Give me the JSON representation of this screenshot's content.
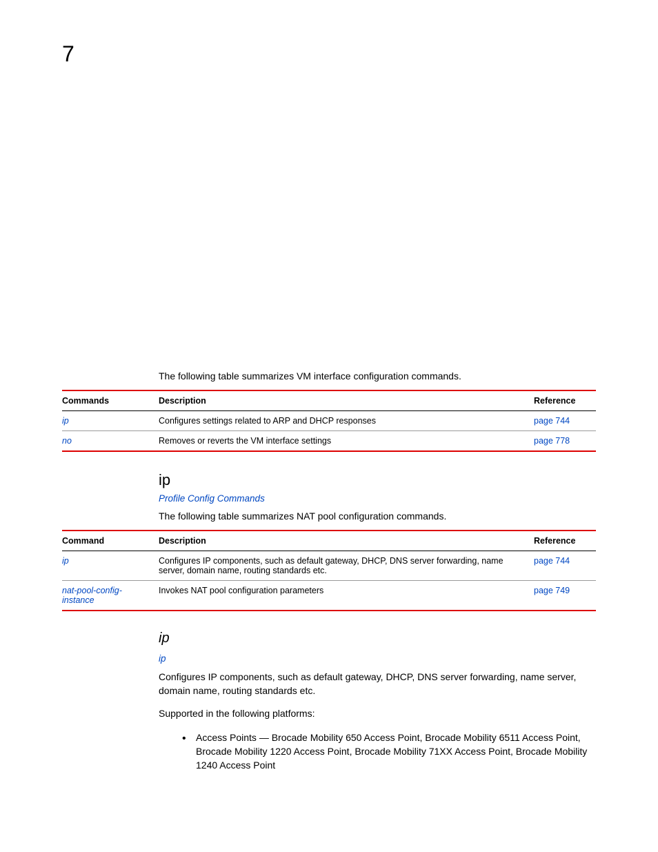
{
  "chapter": "7",
  "intro1": "The following table summarizes VM interface configuration commands.",
  "table1": {
    "headers": {
      "c1": "Commands",
      "c2": "Description",
      "c3": "Reference"
    },
    "rows": [
      {
        "cmd": "ip",
        "desc": "Configures settings related to ARP and DHCP responses",
        "ref": "page 744"
      },
      {
        "cmd": "no",
        "desc": "Removes or reverts the VM interface settings",
        "ref": "page 778"
      }
    ]
  },
  "section1": {
    "heading": "ip",
    "sublink": "Profile Config Commands",
    "intro": "The following table summarizes NAT pool configuration commands."
  },
  "table2": {
    "headers": {
      "c1": "Command",
      "c2": "Description",
      "c3": "Reference"
    },
    "rows": [
      {
        "cmd": "ip",
        "desc": "Configures IP components, such as default gateway, DHCP, DNS server forwarding, name server, domain name, routing standards etc.",
        "ref": "page 744"
      },
      {
        "cmd": "nat-pool-config-instance",
        "desc": "Invokes NAT pool configuration parameters",
        "ref": "page 749"
      }
    ]
  },
  "section2": {
    "heading": "ip",
    "sublink": "ip",
    "para1": "Configures IP components, such as default gateway, DHCP, DNS server forwarding, name server, domain name, routing standards etc.",
    "para2": "Supported in the following platforms:",
    "bullet1": "Access Points — Brocade Mobility 650 Access Point, Brocade Mobility 6511 Access Point, Brocade Mobility 1220 Access Point, Brocade Mobility 71XX Access Point, Brocade Mobility 1240 Access Point"
  }
}
